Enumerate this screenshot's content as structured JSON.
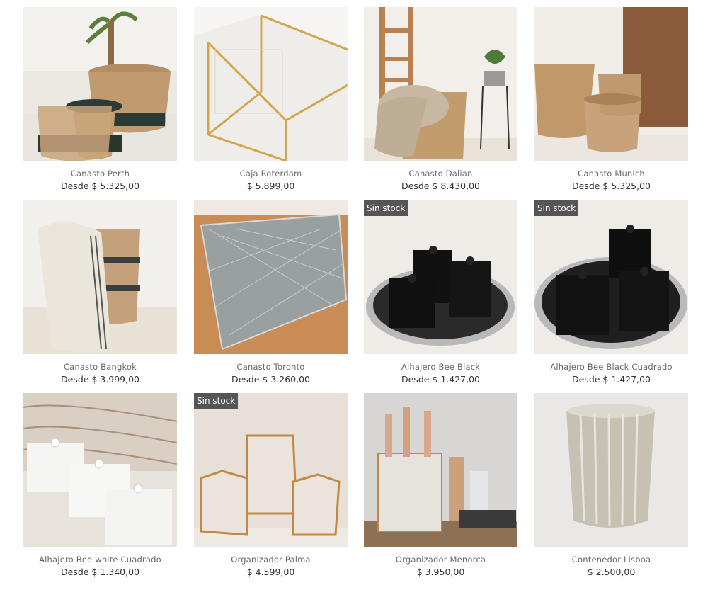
{
  "products": [
    {
      "name": "Canasto Perth",
      "price": "Desde $ 5.325,00",
      "badge": ""
    },
    {
      "name": "Caja Roterdam",
      "price": "$ 5.899,00",
      "badge": ""
    },
    {
      "name": "Canasto Dalian",
      "price": "Desde $ 8.430,00",
      "badge": ""
    },
    {
      "name": "Canasto Munich",
      "price": "Desde $ 5.325,00",
      "badge": ""
    },
    {
      "name": "Canasto Bangkok",
      "price": "Desde $ 3.999,00",
      "badge": ""
    },
    {
      "name": "Canasto Toronto",
      "price": "Desde $ 3.260,00",
      "badge": ""
    },
    {
      "name": "Alhajero Bee Black",
      "price": "Desde $ 1.427,00",
      "badge": "Sin stock"
    },
    {
      "name": "Alhajero Bee Black Cuadrado",
      "price": "Desde $ 1.427,00",
      "badge": "Sin stock"
    },
    {
      "name": "Alhajero Bee white Cuadrado",
      "price": "Desde $ 1.340,00",
      "badge": ""
    },
    {
      "name": "Organizador Palma",
      "price": "$ 4.599,00",
      "badge": "Sin stock"
    },
    {
      "name": "Organizador Menorca",
      "price": "$ 3.950,00",
      "badge": ""
    },
    {
      "name": "Contenedor Lisboa",
      "price": "$ 2.500,00",
      "badge": ""
    }
  ]
}
